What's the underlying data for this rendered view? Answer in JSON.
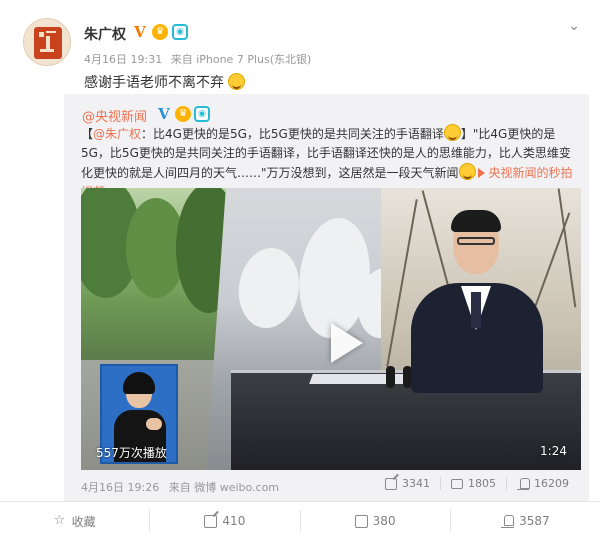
{
  "post": {
    "author": "朱广权",
    "time": "4月16日 19:31",
    "source": "来自 iPhone 7 Plus(东北银)",
    "text": "感谢手语老师不离不弃"
  },
  "repost": {
    "author": "@央视新闻",
    "body_mention": "@朱广权",
    "body_text_1": "：比4G更快的是5G，比5G更快的是共同关注的手语翻译",
    "body_text_2": "\"比4G更快的是5G，比5G更快的是共同关注的手语翻译，比手语翻译还快的是人的思维能力，比人类思维变化更快的就是人间四月的天气……\"万万没想到，这居然是一段天气新闻",
    "video_link": "央视新闻的秒拍视频",
    "video": {
      "play_count": "557万次播放",
      "duration": "1:24"
    },
    "time": "4月16日 19:26",
    "source": "来自 微博 weibo.com",
    "shares": "3341",
    "comments": "1805",
    "likes": "16209"
  },
  "actions": {
    "favorite": "收藏",
    "share": "410",
    "comment": "380",
    "like": "3587"
  },
  "colors": {
    "accent": "#eb7350",
    "verified": "#f07c00",
    "repost_bg": "#f2f2f5"
  }
}
